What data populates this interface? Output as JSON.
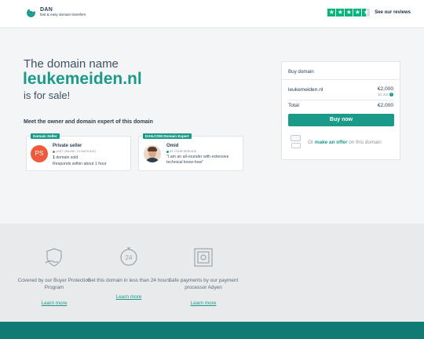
{
  "header": {
    "brand_name": "DAN",
    "brand_tagline": "fast & easy domain transfers",
    "trustpilot_link": "See our reviews",
    "trustpilot_rating_stars": 4.5,
    "brand_color": "#1b9a8a",
    "trust_color": "#00b67a"
  },
  "hero": {
    "line1": "The domain name",
    "domain": "leukemeiden.nl",
    "line3": "is for sale!"
  },
  "meet_heading": "Meet the owner and domain expert of this domain",
  "seller_card": {
    "badge": "Domain Seller",
    "avatar_initials": "PS",
    "avatar_color": "#ef5a3c",
    "name": "Private seller",
    "status": "LAST ONLINE: 13 DAYS AGO",
    "domains_count": "1",
    "domains_label": "domain sold",
    "response": "Responds within about 1 hour"
  },
  "expert_card": {
    "badge": "DAN.COM Domain Expert",
    "name": "Omid",
    "status": "AT YOUR SERVICE",
    "quote": "\"I am an all-rounder with extensive technical know-how\""
  },
  "buy_box": {
    "title": "Buy domain",
    "domain": "leukemeiden.nl",
    "price": "€2,000",
    "price_sub": "$2,493",
    "info_icon": "info-icon",
    "total_label": "Total",
    "total_price": "€2,000",
    "buy_button": "Buy now"
  },
  "offer": {
    "prefix": "Or",
    "link": "make an offer",
    "suffix": "on this domain"
  },
  "features": [
    {
      "icon": "shield-hand-icon",
      "text": "Covered by our Buyer Protection Program",
      "link": "Learn more"
    },
    {
      "icon": "clock-24-icon",
      "text": "Get this domain in less than 24 hours",
      "link": "Learn more"
    },
    {
      "icon": "safe-icon",
      "text": "Safe payments by our payment processor Adyen",
      "link": "Learn more"
    }
  ]
}
